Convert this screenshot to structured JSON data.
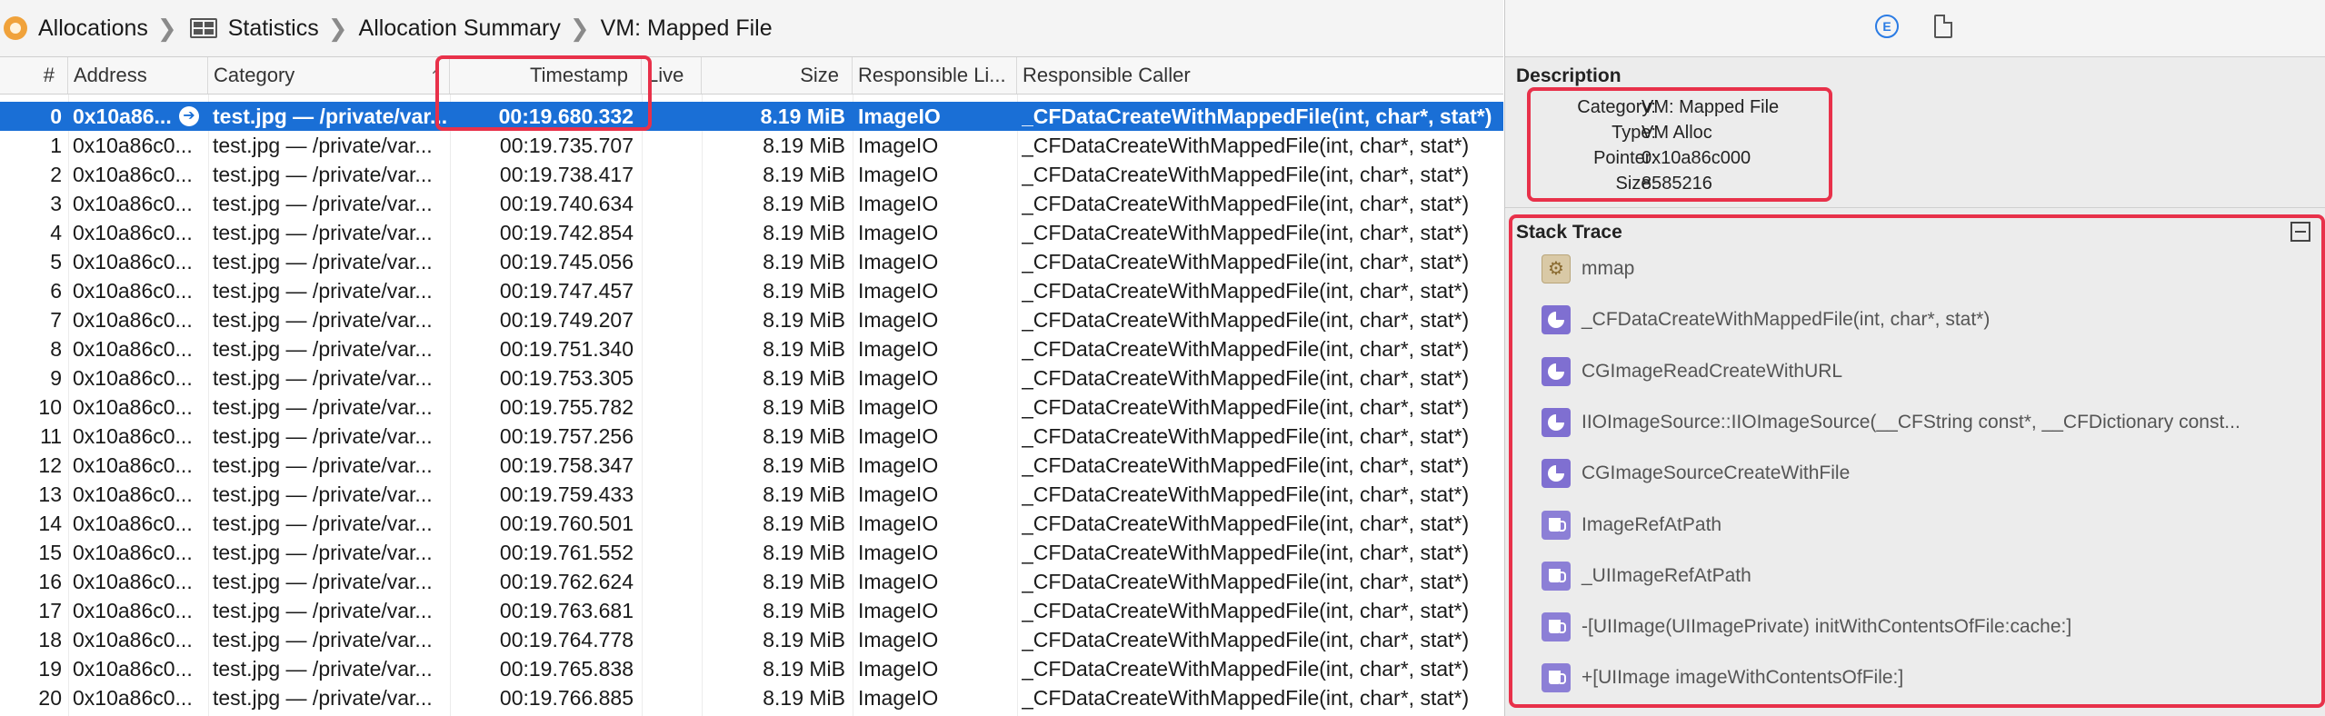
{
  "breadcrumb": {
    "items": [
      "Allocations",
      "Statistics",
      "Allocation Summary",
      "VM: Mapped File"
    ],
    "separator": "❯"
  },
  "table": {
    "columns": [
      "#",
      "Address",
      "Category",
      "Timestamp",
      "Live",
      "Size",
      "Responsible Li...",
      "Responsible Caller"
    ],
    "sorted_column": "Timestamp",
    "selected_row_index": 0,
    "rows": [
      {
        "num": "0",
        "address": "0x10a86...",
        "category": "test.jpg — /private/var...",
        "timestamp": "00:19.680.332",
        "live": "",
        "size": "8.19 MiB",
        "library": "ImageIO",
        "caller": "_CFDataCreateWithMappedFile(int, char*, stat*)"
      },
      {
        "num": "1",
        "address": "0x10a86c0...",
        "category": "test.jpg — /private/var...",
        "timestamp": "00:19.735.707",
        "live": "",
        "size": "8.19 MiB",
        "library": "ImageIO",
        "caller": "_CFDataCreateWithMappedFile(int, char*, stat*)"
      },
      {
        "num": "2",
        "address": "0x10a86c0...",
        "category": "test.jpg — /private/var...",
        "timestamp": "00:19.738.417",
        "live": "",
        "size": "8.19 MiB",
        "library": "ImageIO",
        "caller": "_CFDataCreateWithMappedFile(int, char*, stat*)"
      },
      {
        "num": "3",
        "address": "0x10a86c0...",
        "category": "test.jpg — /private/var...",
        "timestamp": "00:19.740.634",
        "live": "",
        "size": "8.19 MiB",
        "library": "ImageIO",
        "caller": "_CFDataCreateWithMappedFile(int, char*, stat*)"
      },
      {
        "num": "4",
        "address": "0x10a86c0...",
        "category": "test.jpg — /private/var...",
        "timestamp": "00:19.742.854",
        "live": "",
        "size": "8.19 MiB",
        "library": "ImageIO",
        "caller": "_CFDataCreateWithMappedFile(int, char*, stat*)"
      },
      {
        "num": "5",
        "address": "0x10a86c0...",
        "category": "test.jpg — /private/var...",
        "timestamp": "00:19.745.056",
        "live": "",
        "size": "8.19 MiB",
        "library": "ImageIO",
        "caller": "_CFDataCreateWithMappedFile(int, char*, stat*)"
      },
      {
        "num": "6",
        "address": "0x10a86c0...",
        "category": "test.jpg — /private/var...",
        "timestamp": "00:19.747.457",
        "live": "",
        "size": "8.19 MiB",
        "library": "ImageIO",
        "caller": "_CFDataCreateWithMappedFile(int, char*, stat*)"
      },
      {
        "num": "7",
        "address": "0x10a86c0...",
        "category": "test.jpg — /private/var...",
        "timestamp": "00:19.749.207",
        "live": "",
        "size": "8.19 MiB",
        "library": "ImageIO",
        "caller": "_CFDataCreateWithMappedFile(int, char*, stat*)"
      },
      {
        "num": "8",
        "address": "0x10a86c0...",
        "category": "test.jpg — /private/var...",
        "timestamp": "00:19.751.340",
        "live": "",
        "size": "8.19 MiB",
        "library": "ImageIO",
        "caller": "_CFDataCreateWithMappedFile(int, char*, stat*)"
      },
      {
        "num": "9",
        "address": "0x10a86c0...",
        "category": "test.jpg — /private/var...",
        "timestamp": "00:19.753.305",
        "live": "",
        "size": "8.19 MiB",
        "library": "ImageIO",
        "caller": "_CFDataCreateWithMappedFile(int, char*, stat*)"
      },
      {
        "num": "10",
        "address": "0x10a86c0...",
        "category": "test.jpg — /private/var...",
        "timestamp": "00:19.755.782",
        "live": "",
        "size": "8.19 MiB",
        "library": "ImageIO",
        "caller": "_CFDataCreateWithMappedFile(int, char*, stat*)"
      },
      {
        "num": "11",
        "address": "0x10a86c0...",
        "category": "test.jpg — /private/var...",
        "timestamp": "00:19.757.256",
        "live": "",
        "size": "8.19 MiB",
        "library": "ImageIO",
        "caller": "_CFDataCreateWithMappedFile(int, char*, stat*)"
      },
      {
        "num": "12",
        "address": "0x10a86c0...",
        "category": "test.jpg — /private/var...",
        "timestamp": "00:19.758.347",
        "live": "",
        "size": "8.19 MiB",
        "library": "ImageIO",
        "caller": "_CFDataCreateWithMappedFile(int, char*, stat*)"
      },
      {
        "num": "13",
        "address": "0x10a86c0...",
        "category": "test.jpg — /private/var...",
        "timestamp": "00:19.759.433",
        "live": "",
        "size": "8.19 MiB",
        "library": "ImageIO",
        "caller": "_CFDataCreateWithMappedFile(int, char*, stat*)"
      },
      {
        "num": "14",
        "address": "0x10a86c0...",
        "category": "test.jpg — /private/var...",
        "timestamp": "00:19.760.501",
        "live": "",
        "size": "8.19 MiB",
        "library": "ImageIO",
        "caller": "_CFDataCreateWithMappedFile(int, char*, stat*)"
      },
      {
        "num": "15",
        "address": "0x10a86c0...",
        "category": "test.jpg — /private/var...",
        "timestamp": "00:19.761.552",
        "live": "",
        "size": "8.19 MiB",
        "library": "ImageIO",
        "caller": "_CFDataCreateWithMappedFile(int, char*, stat*)"
      },
      {
        "num": "16",
        "address": "0x10a86c0...",
        "category": "test.jpg — /private/var...",
        "timestamp": "00:19.762.624",
        "live": "",
        "size": "8.19 MiB",
        "library": "ImageIO",
        "caller": "_CFDataCreateWithMappedFile(int, char*, stat*)"
      },
      {
        "num": "17",
        "address": "0x10a86c0...",
        "category": "test.jpg — /private/var...",
        "timestamp": "00:19.763.681",
        "live": "",
        "size": "8.19 MiB",
        "library": "ImageIO",
        "caller": "_CFDataCreateWithMappedFile(int, char*, stat*)"
      },
      {
        "num": "18",
        "address": "0x10a86c0...",
        "category": "test.jpg — /private/var...",
        "timestamp": "00:19.764.778",
        "live": "",
        "size": "8.19 MiB",
        "library": "ImageIO",
        "caller": "_CFDataCreateWithMappedFile(int, char*, stat*)"
      },
      {
        "num": "19",
        "address": "0x10a86c0...",
        "category": "test.jpg — /private/var...",
        "timestamp": "00:19.765.838",
        "live": "",
        "size": "8.19 MiB",
        "library": "ImageIO",
        "caller": "_CFDataCreateWithMappedFile(int, char*, stat*)"
      },
      {
        "num": "20",
        "address": "0x10a86c0...",
        "category": "test.jpg — /private/var...",
        "timestamp": "00:19.766.885",
        "live": "",
        "size": "8.19 MiB",
        "library": "ImageIO",
        "caller": "_CFDataCreateWithMappedFile(int, char*, stat*)"
      }
    ]
  },
  "inspector": {
    "description_title": "Description",
    "description": [
      {
        "key": "Category:",
        "value": "VM: Mapped File"
      },
      {
        "key": "Type:",
        "value": "VM Alloc"
      },
      {
        "key": "Pointer:",
        "value": "0x10a86c000"
      },
      {
        "key": "Size:",
        "value": "8585216"
      }
    ],
    "stack_title": "Stack Trace",
    "stack": [
      {
        "icon": "gear",
        "label": "mmap"
      },
      {
        "icon": "pie",
        "label": "_CFDataCreateWithMappedFile(int, char*, stat*)"
      },
      {
        "icon": "pie",
        "label": "CGImageReadCreateWithURL"
      },
      {
        "icon": "pie",
        "label": "IIOImageSource::IIOImageSource(__CFString const*, __CFDictionary const..."
      },
      {
        "icon": "pie",
        "label": "CGImageSourceCreateWithFile"
      },
      {
        "icon": "mug",
        "label": "ImageRefAtPath"
      },
      {
        "icon": "mug",
        "label": "_UIImageRefAtPath"
      },
      {
        "icon": "mug",
        "label": "-[UIImage(UIImagePrivate) initWithContentsOfFile:cache:]"
      },
      {
        "icon": "mug",
        "label": "+[UIImage imageWithContentsOfFile:]"
      }
    ]
  },
  "colors": {
    "selection": "#1a6fd6",
    "highlight": "#e8314a",
    "accent": "#2a7be4"
  }
}
